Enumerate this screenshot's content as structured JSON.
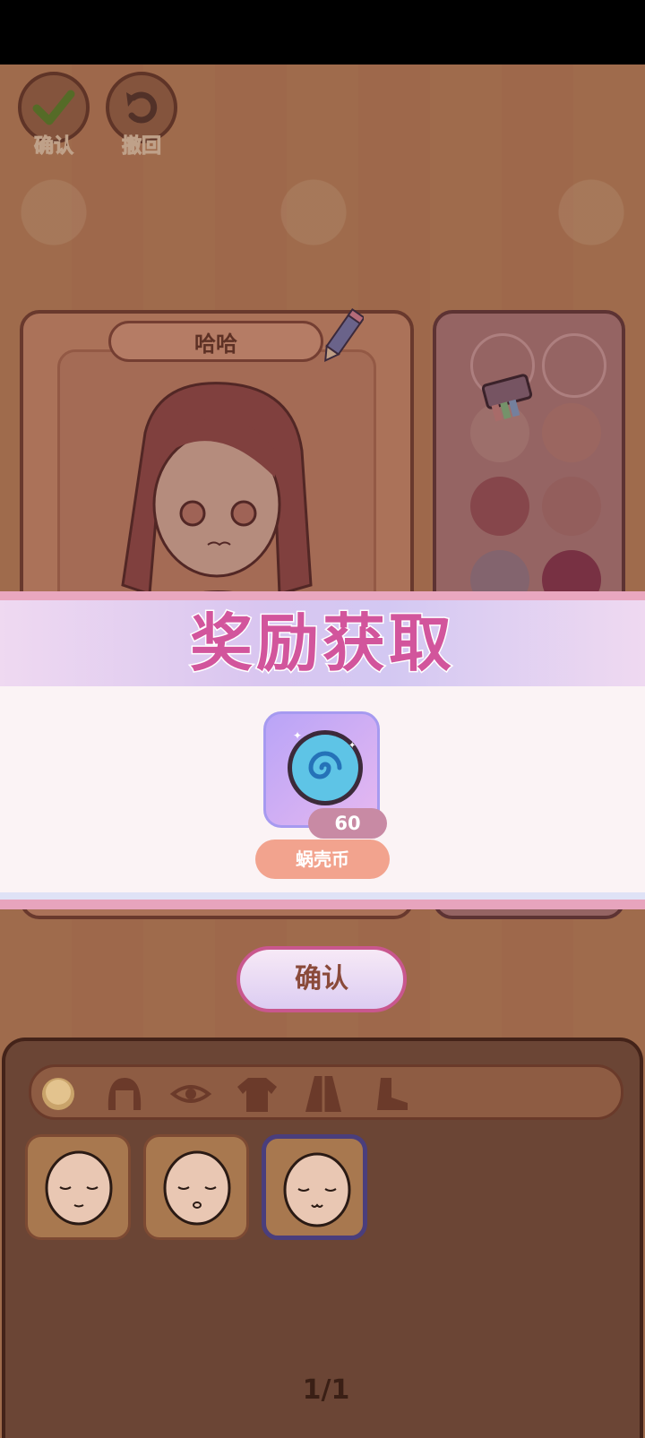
{
  "top_bar": {
    "confirm_label": "确认",
    "undo_label": "撤回"
  },
  "character": {
    "name": "哈哈"
  },
  "reward": {
    "title": "奖励获取",
    "item_name": "蜗壳币",
    "item_count": "60",
    "confirm_label": "确认"
  },
  "colors": {
    "swatches": [
      "#c99a9c",
      "#c99a9c",
      "#c28f8c",
      "#b87676",
      "#a35660",
      "#b47878",
      "#9e8090",
      "#8f3a55"
    ]
  },
  "tabs": [
    "face-tab-icon",
    "hair-tab-icon",
    "eye-tab-icon",
    "top-tab-icon",
    "dress-tab-icon",
    "shoe-tab-icon"
  ],
  "pagination": {
    "text": "1/1"
  }
}
